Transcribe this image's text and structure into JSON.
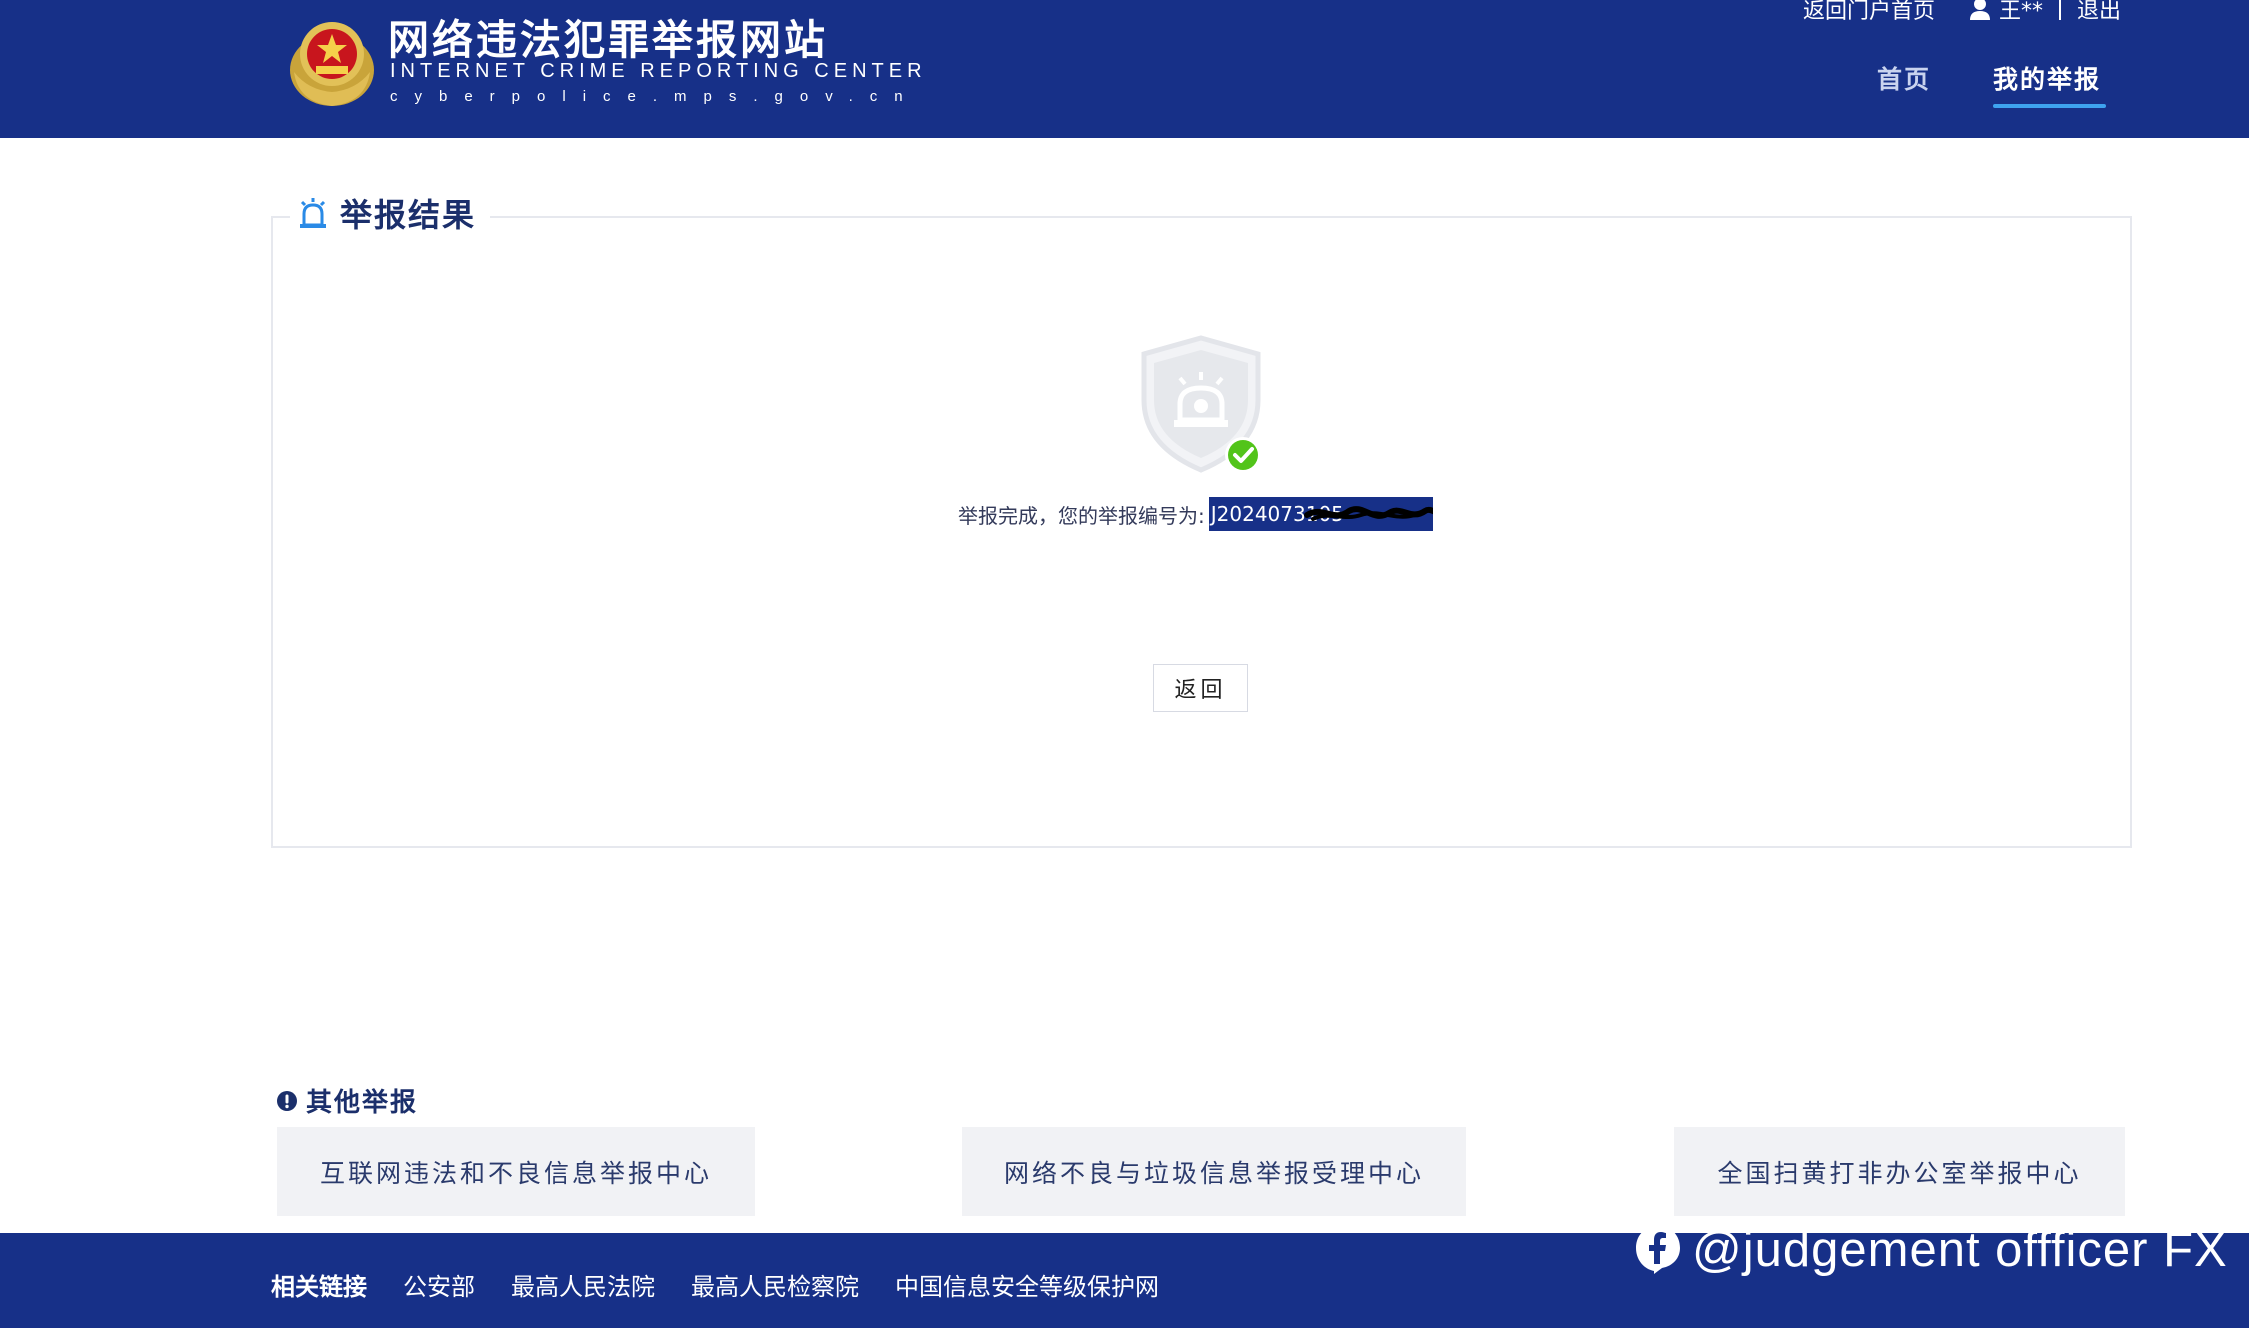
{
  "header": {
    "title": "网络违法犯罪举报网站",
    "subtitle": "INTERNET CRIME REPORTING CENTER",
    "domain": "cyberpolice.mps.gov.cn",
    "portal_link": "返回门户首页",
    "user_name": "王**",
    "logout": "退出",
    "nav": {
      "home": "首页",
      "my_reports": "我的举报"
    }
  },
  "result": {
    "section_title": "举报结果",
    "message": "举报完成，您的举报编号为:",
    "report_number": "J2024073105",
    "back_button": "返回"
  },
  "other_reports": {
    "title": "其他举报",
    "links": [
      "互联网违法和不良信息举报中心",
      "网络不良与垃圾信息举报受理中心",
      "全国扫黄打非办公室举报中心"
    ]
  },
  "footer": {
    "label": "相关链接",
    "links": [
      "公安部",
      "最高人民法院",
      "最高人民检察院",
      "中国信息安全等级保护网"
    ]
  },
  "watermark": {
    "text": "@judgement offficer FX"
  },
  "colors": {
    "brand_blue": "#173088",
    "accent": "#3ea3f0",
    "success": "#52c41a"
  }
}
